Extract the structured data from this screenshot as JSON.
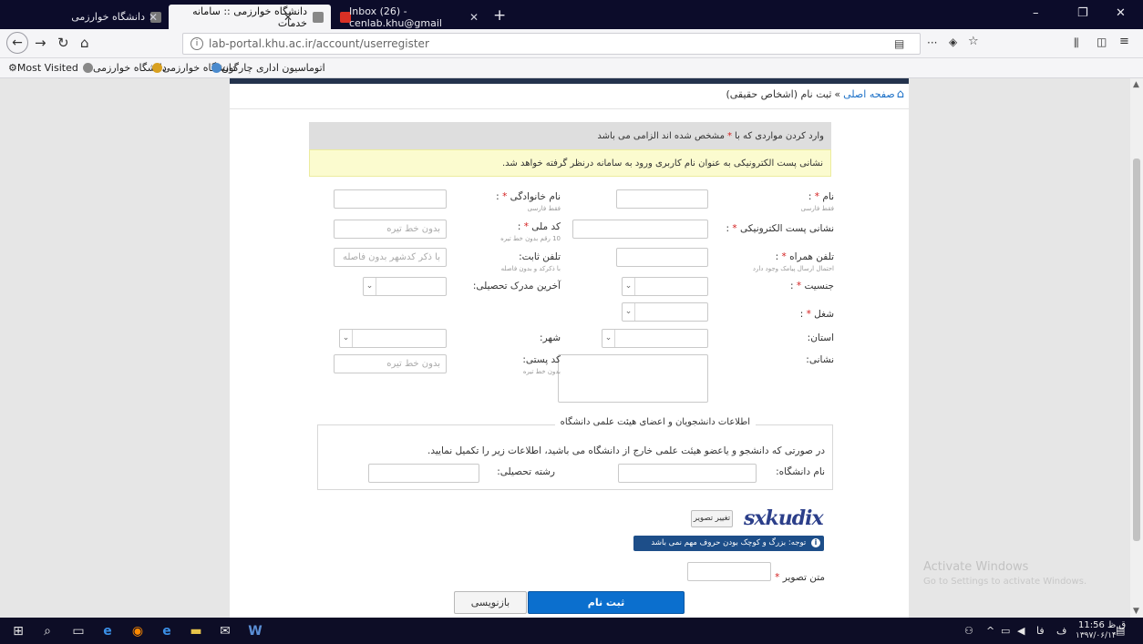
{
  "browser": {
    "tabs": [
      {
        "label": "دانشگاه خوارزمی",
        "active": false
      },
      {
        "label": "دانشگاه خوارزمی :: سامانه خدمات",
        "active": true
      },
      {
        "label": "Inbox (26) - cenlab.khu@gmail",
        "active": false
      }
    ],
    "new_tab_glyph": "+",
    "url": "lab-portal.khu.ac.ir/account/userregister",
    "bookmarks": [
      {
        "label": "Most Visited"
      },
      {
        "label": "دانشگاه خوارزمی"
      },
      {
        "label": "دانشگاه خوارزمی"
      },
      {
        "label": "اتوماسیون اداری چارگون"
      },
      {
        "label": "سامانه آموزش گلستان"
      }
    ]
  },
  "page": {
    "breadcrumb": {
      "home": "صفحه اصلی",
      "separator": "»",
      "current": "ثبت نام (اشخاص حقیقی)"
    },
    "notice_required": {
      "prefix": "وارد کردن مواردی که با",
      "star": "*",
      "suffix": "مشخص شده اند الزامی می باشد"
    },
    "notice_email": "نشانی پست الکترونیکی به عنوان نام کاربری ورود به سامانه درنظر گرفته خواهد شد.",
    "form": {
      "first_name": {
        "label": "نام",
        "hint": "فقط فارسی"
      },
      "last_name": {
        "label": "نام خانوادگی",
        "hint": "فقط فارسی"
      },
      "email": {
        "label": "نشانی پست الکترونیکی"
      },
      "national_code": {
        "label": "کد ملی",
        "hint": "10 رقم بدون خط تیره",
        "placeholder": "بدون خط تیره"
      },
      "mobile": {
        "label": "تلفن همراه",
        "hint": "احتمال ارسال پیامک وجود دارد"
      },
      "phone": {
        "label": "تلفن ثابت:",
        "hint": "با ذکرکد و بدون فاصله",
        "placeholder": "با ذکر کدشهر بدون فاصله"
      },
      "gender": {
        "label": "جنسیت"
      },
      "education": {
        "label": "آخرین مدرک تحصیلی:"
      },
      "job": {
        "label": "شغل"
      },
      "province": {
        "label": "استان:"
      },
      "city": {
        "label": "شهر:"
      },
      "address": {
        "label": "نشانی:"
      },
      "postal_code": {
        "label": "کد پستی:",
        "hint": "بدون خط تیره",
        "placeholder": "بدون خط تیره"
      },
      "university_section": {
        "legend": "اطلاعات دانشجویان و اعضای هیئت علمی دانشگاه",
        "description": "در صورتی که دانشجو و یاعضو هیئت علمی خارج از دانشگاه می باشید، اطلاعات زیر را تکمیل نمایید.",
        "university": {
          "label": "نام دانشگاه:"
        },
        "major": {
          "label": "رشته تحصیلی:"
        }
      },
      "captcha": {
        "image_text": "sxkudix",
        "refresh_label": "تغییر تصویر",
        "note": "توجه: بزرگ و کوچک بودن حروف مهم نمی باشد",
        "label": "متن تصویر"
      },
      "submit_label": "ثبت نام",
      "reset_label": "بازنویسی"
    }
  },
  "watermark": {
    "title": "Activate Windows",
    "subtitle": "Go to Settings to activate Windows."
  },
  "taskbar": {
    "tray_lang": "فا",
    "clock_time": "11:56 ق.ظ",
    "clock_date": "۱۳۹۷/۰۶/۱۴"
  }
}
